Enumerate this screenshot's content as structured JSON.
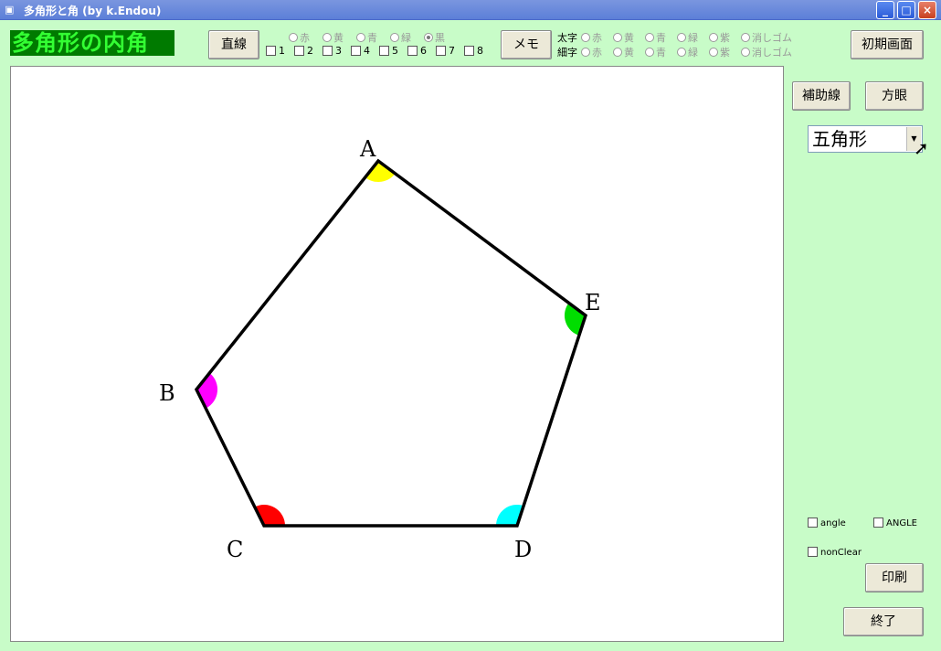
{
  "window": {
    "title": "多角形と角 (by k.Endou)",
    "minimize": "_",
    "maximize": "□",
    "close": "×"
  },
  "app_title": "多角形の内角",
  "toolbar": {
    "line_button": "直線",
    "memo_button": "メモ",
    "reset_button": "初期画面",
    "line_colors": [
      "赤",
      "黄",
      "青",
      "緑",
      "黒"
    ],
    "line_color_selected": "黒",
    "layer_checkboxes": [
      "1",
      "2",
      "3",
      "4",
      "5",
      "6",
      "7",
      "8"
    ],
    "memo_thick_label": "太字",
    "memo_thin_label": "細字",
    "memo_colors": [
      "赤",
      "黄",
      "青",
      "緑",
      "紫",
      "消しゴム"
    ]
  },
  "side": {
    "aux_line_button": "補助線",
    "grid_button": "方眼",
    "shape_select_value": "五角形",
    "angle_checkbox": "angle",
    "ANGLE_checkbox": "ANGLE",
    "nonclear_checkbox": "nonClear",
    "print_button": "印刷",
    "exit_button": "終了"
  },
  "polygon": {
    "vertices": [
      {
        "label": "A",
        "color": "#ffff00"
      },
      {
        "label": "B",
        "color": "#ff00ff"
      },
      {
        "label": "C",
        "color": "#ff0000"
      },
      {
        "label": "D",
        "color": "#00ffff"
      },
      {
        "label": "E",
        "color": "#00dd00"
      }
    ],
    "stroke_color": "#000000"
  }
}
